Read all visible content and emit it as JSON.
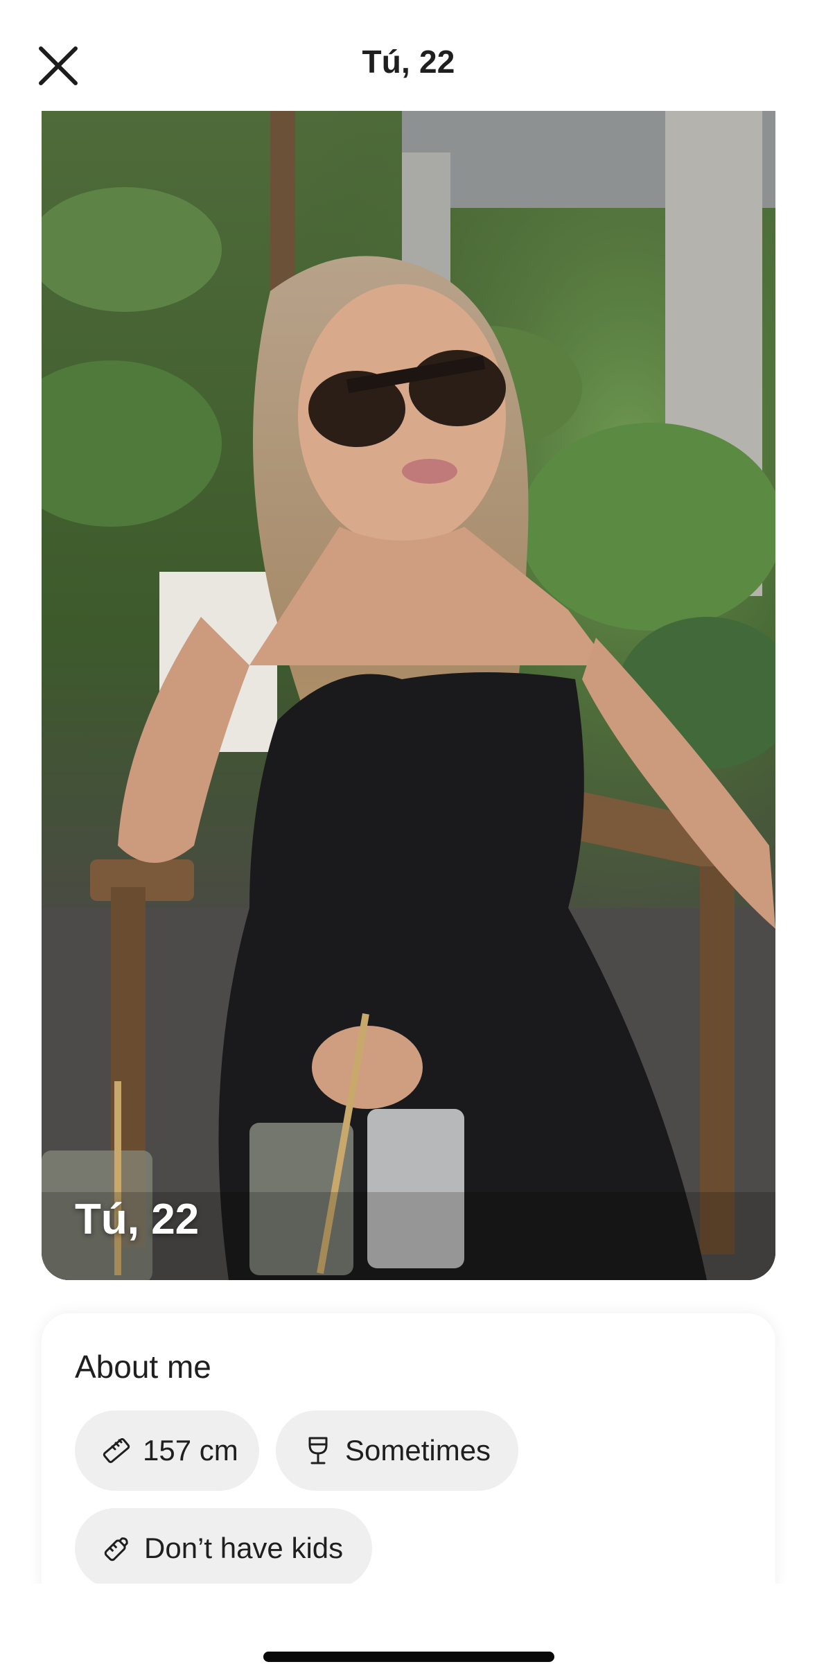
{
  "header": {
    "title": "Tú, 22",
    "close_icon": "close-icon"
  },
  "photo": {
    "caption": "Tú, 22"
  },
  "about": {
    "title": "About me",
    "chips": [
      {
        "label": "157 cm",
        "icon": "ruler-icon"
      },
      {
        "label": "Sometimes",
        "icon": "wine-glass-icon"
      },
      {
        "label": "Don’t have kids",
        "icon": "baby-bottle-icon"
      }
    ]
  },
  "colors": {
    "chip_background": "#efefef",
    "text": "#1f1f1f",
    "background": "#ffffff"
  }
}
